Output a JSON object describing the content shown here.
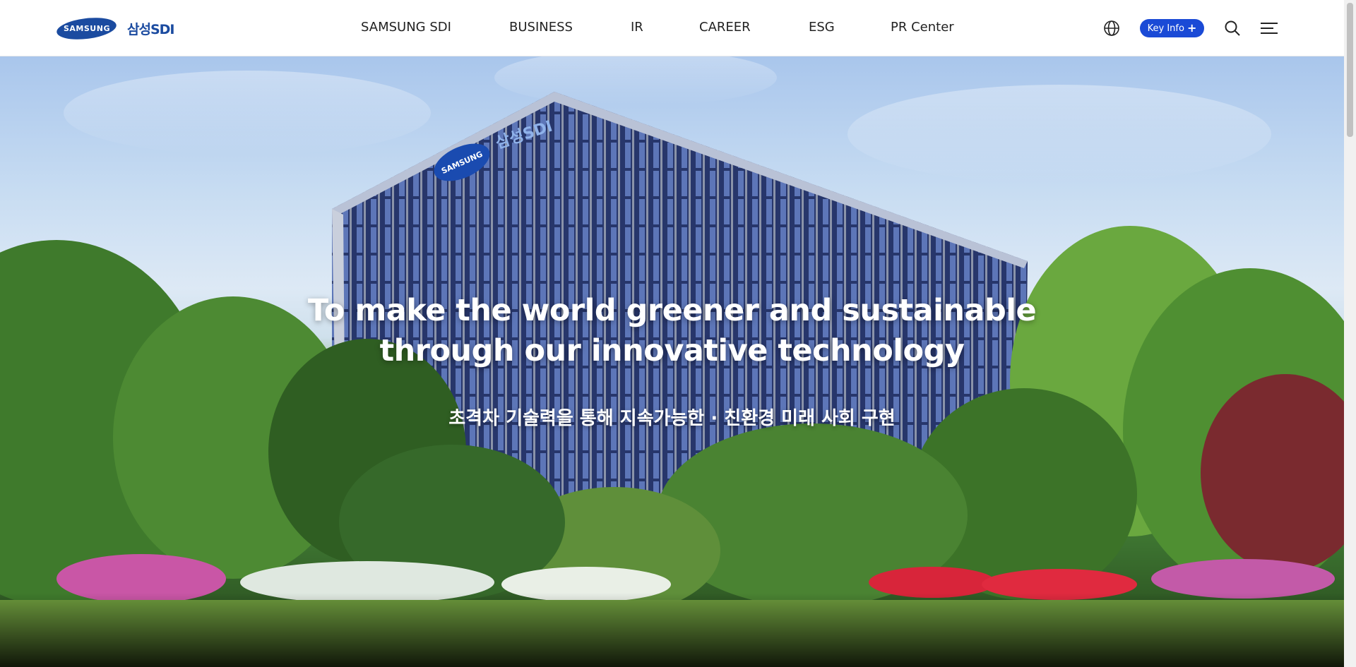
{
  "brand": {
    "logo_oval_text": "SAMSUNG",
    "logo_korean_text": "삼성SDI",
    "brand_color": "#1b4ba0"
  },
  "nav": {
    "items": [
      {
        "label": "SAMSUNG SDI"
      },
      {
        "label": "BUSINESS"
      },
      {
        "label": "IR"
      },
      {
        "label": "CAREER"
      },
      {
        "label": "ESG"
      },
      {
        "label": "PR Center"
      }
    ]
  },
  "utilities": {
    "language_icon": "globe-icon",
    "key_info_label": "Key Info",
    "key_info_icon": "plus-icon",
    "key_info_color": "#1a4ad6",
    "search_icon": "search-icon",
    "menu_icon": "menu-icon"
  },
  "hero": {
    "headline_line1": "To make the world greener and sustainable",
    "headline_line2": "through our innovative technology",
    "subheadline": "초격차 기술력을 통해 지속가능한 · 친환경 미래 사회 구현",
    "building_sign_text": "SAMSUNG",
    "building_sign_korean": "삼성SDI"
  }
}
